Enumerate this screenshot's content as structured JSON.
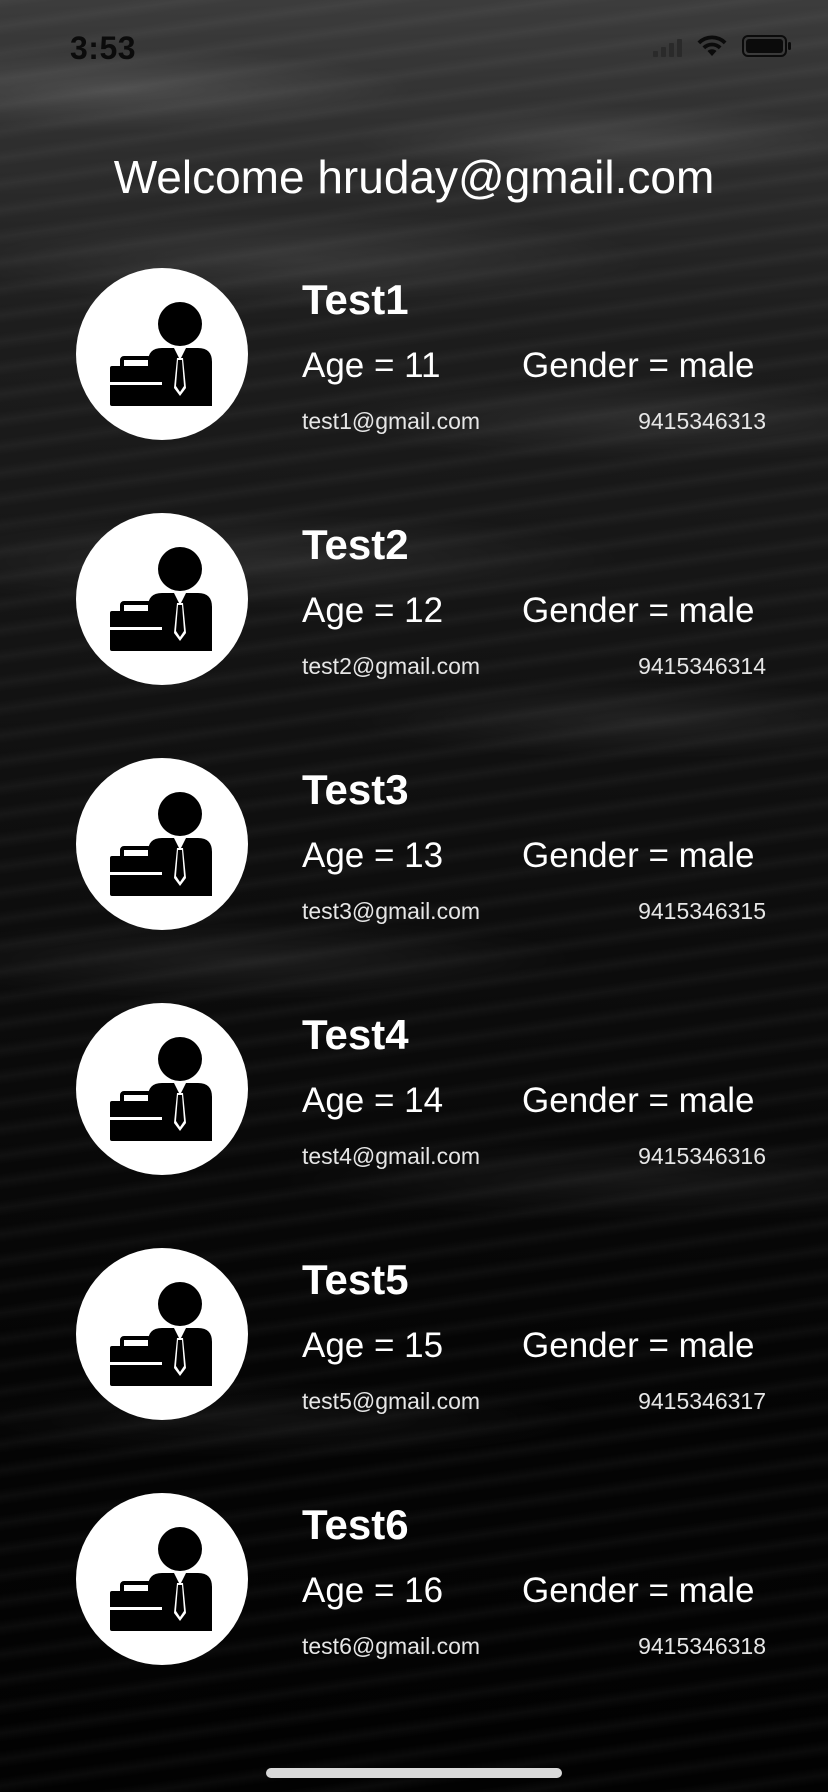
{
  "status_bar": {
    "time": "3:53",
    "icons": [
      "signal-icon",
      "wifi-icon",
      "battery-icon"
    ]
  },
  "header": {
    "welcome_text": "Welcome hruday@gmail.com"
  },
  "users": [
    {
      "name": "Test1",
      "age": "Age = 11",
      "gender": "Gender = male",
      "email": "test1@gmail.com",
      "phone": "9415346313",
      "avatar_icon": "businessman-icon"
    },
    {
      "name": "Test2",
      "age": "Age = 12",
      "gender": "Gender = male",
      "email": "test2@gmail.com",
      "phone": "9415346314",
      "avatar_icon": "businessman-icon"
    },
    {
      "name": "Test3",
      "age": "Age = 13",
      "gender": "Gender = male",
      "email": "test3@gmail.com",
      "phone": "9415346315",
      "avatar_icon": "businessman-icon"
    },
    {
      "name": "Test4",
      "age": "Age = 14",
      "gender": "Gender = male",
      "email": "test4@gmail.com",
      "phone": "9415346316",
      "avatar_icon": "businessman-icon"
    },
    {
      "name": "Test5",
      "age": "Age = 15",
      "gender": "Gender = male",
      "email": "test5@gmail.com",
      "phone": "9415346317",
      "avatar_icon": "businessman-icon"
    },
    {
      "name": "Test6",
      "age": "Age = 16",
      "gender": "Gender = male",
      "email": "test6@gmail.com",
      "phone": "9415346318",
      "avatar_icon": "businessman-icon"
    }
  ],
  "colors": {
    "text": "#ffffff",
    "avatar_bg": "#ffffff",
    "icon_fill": "#000000"
  }
}
